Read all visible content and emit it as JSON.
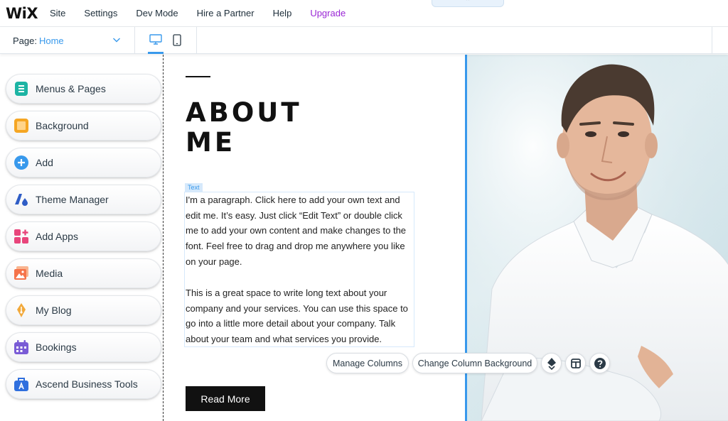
{
  "topbar": {
    "logo": "WiX",
    "menu": [
      "Site",
      "Settings",
      "Dev Mode",
      "Hire a Partner",
      "Help"
    ],
    "upgrade": "Upgrade",
    "collapse_glyph": "⌃"
  },
  "pagebar": {
    "label": "Page:",
    "current_page": "Home"
  },
  "tools": [
    {
      "label": "Menus & Pages",
      "icon": "menus-pages-icon",
      "color": "#1db4a4"
    },
    {
      "label": "Background",
      "icon": "background-icon",
      "color": "#f5a623"
    },
    {
      "label": "Add",
      "icon": "add-icon",
      "color": "#3899ec"
    },
    {
      "label": "Theme Manager",
      "icon": "theme-manager-icon",
      "color": "#2f5dc6"
    },
    {
      "label": "Add Apps",
      "icon": "add-apps-icon",
      "color": "#e8457b"
    },
    {
      "label": "Media",
      "icon": "media-icon",
      "color": "#f5734a"
    },
    {
      "label": "My Blog",
      "icon": "blog-pen-icon",
      "color": "#f2a93b"
    },
    {
      "label": "Bookings",
      "icon": "bookings-calendar-icon",
      "color": "#7a5cd6"
    },
    {
      "label": "Ascend Business Tools",
      "icon": "ascend-briefcase-icon",
      "color": "#2f6fde"
    }
  ],
  "content": {
    "title_line1": "ABOUT",
    "title_line2": "ME",
    "text_tag": "Text",
    "paragraph1": "I'm a paragraph. Click here to add your own text and edit me. It’s easy. Just click “Edit Text” or double click me to add your own content and make changes to the font. Feel free to drag and drop me anywhere you like on your page.",
    "paragraph2": "This is a great space to write long text about your company and your services. You can use this space to go into a little more detail about your company. Talk about your team and what services you provide.",
    "read_more": "Read More"
  },
  "floating_toolbar": {
    "manage_columns": "Manage Columns",
    "change_background": "Change Column Background"
  },
  "colors": {
    "accent": "#3899ec",
    "upgrade": "#9a27d5"
  }
}
